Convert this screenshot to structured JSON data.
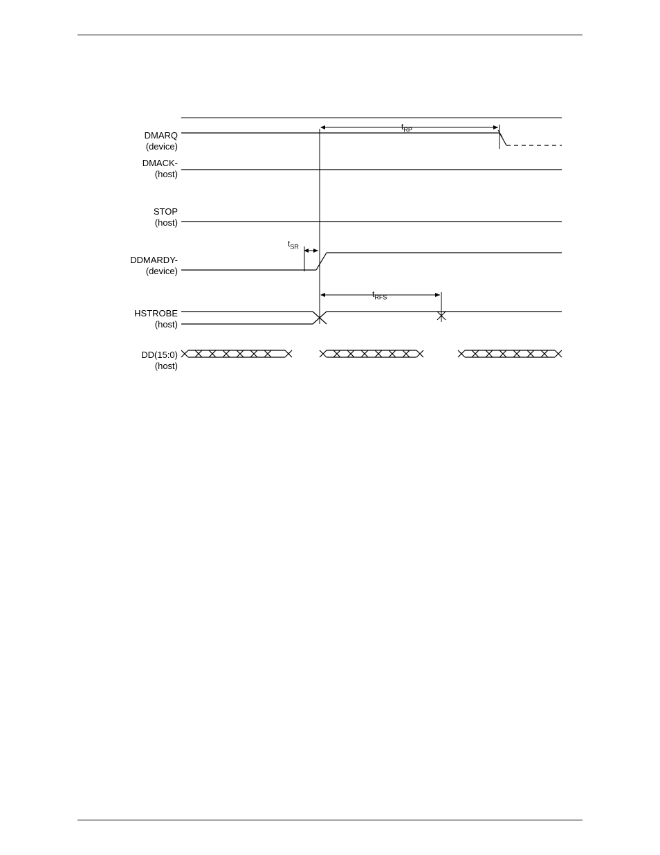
{
  "signals": {
    "dmarq": {
      "name": "DMARQ",
      "src": "(device)"
    },
    "dmack": {
      "name": "DMACK-",
      "src": "(host)"
    },
    "stop": {
      "name": "STOP",
      "src": "(host)"
    },
    "ddmardy": {
      "name": "DDMARDY-",
      "src": "(device)"
    },
    "hstrobe": {
      "name": "HSTROBE",
      "src": "(host)"
    },
    "dd": {
      "name": "DD(15:0)",
      "src": "(host)"
    }
  },
  "timings": {
    "tsr": "t",
    "tsr_sub": "SR",
    "trp": "t",
    "trp_sub": "RP",
    "trfs": "t",
    "trfs_sub": "RFS"
  }
}
